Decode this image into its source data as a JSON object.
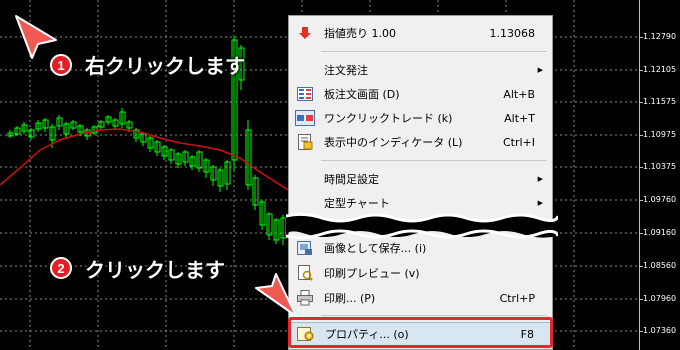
{
  "chart": {
    "price_labels": [
      "1.12790",
      "1.12105",
      "1.11575",
      "1.10975",
      "1.10375",
      "1.09760",
      "1.09160",
      "1.08560",
      "1.07960",
      "1.07360"
    ],
    "grid_color": "#8a8a8a",
    "candle_color": "#00ff00",
    "ma_color": "#d01010"
  },
  "menu": {
    "items": [
      {
        "label": "指値売り 1.00",
        "shortcut": "1.13068",
        "icon": "sell-limit-arrow-icon"
      },
      {
        "label": "注文発注",
        "icon": ""
      },
      {
        "label": "板注文画面 (D)",
        "shortcut": "Alt+B",
        "icon": "depth-of-market-icon"
      },
      {
        "label": "ワンクリックトレード (k)",
        "shortcut": "Alt+T",
        "icon": "one-click-trading-icon"
      },
      {
        "label": "表示中のインディケータ (L)",
        "shortcut": "Ctrl+I",
        "icon": "indicators-list-icon"
      },
      {
        "label": "時間足設定",
        "icon": ""
      },
      {
        "label": "定型チャート",
        "icon": ""
      },
      {
        "label": "画像として保存... (i)",
        "icon": "save-image-icon"
      },
      {
        "label": "印刷プレビュー (v)",
        "icon": "print-preview-icon"
      },
      {
        "label": "印刷... (P)",
        "shortcut": "Ctrl+P",
        "icon": "printer-icon"
      },
      {
        "label": "プロパティ... (o)",
        "shortcut": "F8",
        "icon": "properties-icon"
      }
    ]
  },
  "annotations": {
    "step1_number": "1",
    "step1_text": "右クリックします",
    "step2_number": "2",
    "step2_text": "クリックします",
    "highlight_color": "#e8262c"
  }
}
